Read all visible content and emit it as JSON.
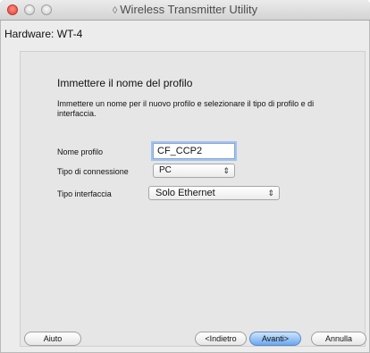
{
  "window": {
    "title": "Wireless Transmitter Utility",
    "title_icon": "app-icon"
  },
  "hardware_label": "Hardware: WT-4",
  "section": {
    "heading": "Immettere il nome del profilo",
    "description": "Immettere un nome per il nuovo profilo e selezionare il tipo di profilo e di interfaccia."
  },
  "form": {
    "profile_name_label": "Nome profilo",
    "profile_name_value": "CF_CCP2",
    "connection_type_label": "Tipo di connessione",
    "connection_type_value": "PC",
    "interface_type_label": "Tipo interfaccia",
    "interface_type_value": "Solo Ethernet"
  },
  "buttons": {
    "help": "Aiuto",
    "back": "<Indietro",
    "next": "Avanti>",
    "cancel": "Annulla"
  },
  "colors": {
    "accent": "#6aa8ef",
    "close_button": "#e0443e"
  }
}
